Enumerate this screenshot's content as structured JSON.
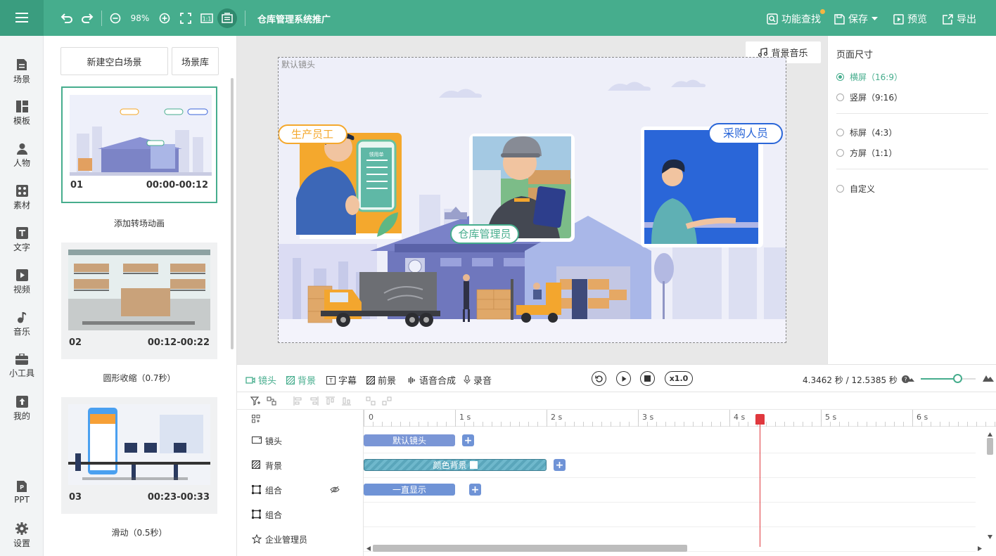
{
  "toolbar": {
    "zoom": "98%",
    "project_title": "仓库管理系统推广",
    "find_label": "功能查找",
    "save_label": "保存",
    "preview_label": "预览",
    "export_label": "导出"
  },
  "nav": {
    "items": [
      "场景",
      "模板",
      "人物",
      "素材",
      "文字",
      "视频",
      "音乐",
      "小工具",
      "我的"
    ],
    "ppt": "PPT",
    "settings": "设置"
  },
  "scenes": {
    "new_blank": "新建空白场景",
    "library": "场景库",
    "cards": [
      {
        "num": "01",
        "time": "00:00-00:12",
        "transition": "添加转场动画"
      },
      {
        "num": "02",
        "time": "00:12-00:22",
        "transition": "圆形收缩（0.7秒）"
      },
      {
        "num": "03",
        "time": "00:23-00:33",
        "transition": "滑动（0.5秒）"
      }
    ]
  },
  "stage": {
    "bg_music": "背景音乐",
    "camera_label": "默认镜头",
    "tags": {
      "worker": "生产员工",
      "manager": "仓库管理员",
      "buyer": "采购人员"
    },
    "phone_title": "领用单"
  },
  "page_size": {
    "title": "页面尺寸",
    "options": [
      "横屏（16:9）",
      "竖屏（9:16）",
      "标屏（4:3）",
      "方屏（1:1）",
      "自定义"
    ],
    "selected": "横屏（16:9）"
  },
  "timeline": {
    "tabs": [
      "镜头",
      "背景",
      "字幕",
      "前景",
      "语音合成",
      "录音"
    ],
    "speed": "x1.0",
    "time": "4.3462 秒 / 12.5385 秒",
    "ticks": [
      "0",
      "1 s",
      "2 s",
      "3 s",
      "4 s",
      "5 s",
      "6 s"
    ],
    "tracks": [
      {
        "label": "镜头",
        "clip": "默认镜头"
      },
      {
        "label": "背景",
        "clip": "颜色背景"
      },
      {
        "label": "组合",
        "clip": "一直显示"
      },
      {
        "label": "组合",
        "clip": ""
      },
      {
        "label": "企业管理员",
        "clip": ""
      }
    ]
  },
  "colors": {
    "accent": "#46ad8d",
    "clip_blue": "#6f93d6",
    "playhead": "#e0383e"
  }
}
